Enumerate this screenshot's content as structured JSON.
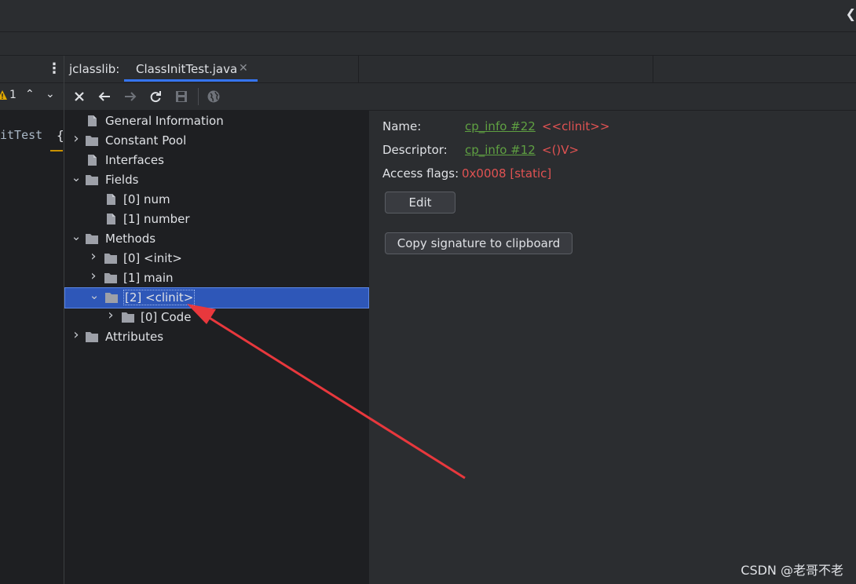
{
  "editor": {
    "warning_count": "1",
    "code_text": "itTest",
    "code_brace": "{"
  },
  "tabs": {
    "plugin_label": "jclasslib:",
    "file_tab": "ClassInitTest.java"
  },
  "toolbar": {
    "buttons": [
      "close-icon",
      "back-icon",
      "forward-icon",
      "refresh-icon",
      "save-icon",
      "browser-icon"
    ]
  },
  "tree": {
    "items": [
      {
        "label": "General Information",
        "kind": "file",
        "expand": "none"
      },
      {
        "label": "Constant Pool",
        "kind": "folder",
        "expand": "collapsed"
      },
      {
        "label": "Interfaces",
        "kind": "file",
        "expand": "none"
      },
      {
        "label": "Fields",
        "kind": "folder",
        "expand": "expanded"
      },
      {
        "label": "[0] num",
        "kind": "file",
        "expand": "none"
      },
      {
        "label": "[1] number",
        "kind": "file",
        "expand": "none"
      },
      {
        "label": "Methods",
        "kind": "folder",
        "expand": "expanded"
      },
      {
        "label": "[0] <init>",
        "kind": "folder",
        "expand": "collapsed"
      },
      {
        "label": "[1] main",
        "kind": "folder",
        "expand": "collapsed"
      },
      {
        "label": "[2] <clinit>",
        "kind": "folder",
        "expand": "expanded",
        "selected": true
      },
      {
        "label": "[0] Code",
        "kind": "folder",
        "expand": "collapsed"
      },
      {
        "label": "Attributes",
        "kind": "folder",
        "expand": "collapsed"
      }
    ]
  },
  "detail": {
    "name_label": "Name:",
    "name_link": "cp_info #22",
    "name_value": "<<clinit>>",
    "descriptor_label": "Descriptor:",
    "descriptor_link": "cp_info #12",
    "descriptor_value": "<()V>",
    "flags_label": "Access flags:",
    "flags_value": "0x0008 [static]",
    "edit_button": "Edit",
    "copy_button": "Copy signature to clipboard"
  },
  "watermark": "CSDN @老哥不老",
  "colors": {
    "selection": "#2e57b8",
    "link": "#5fa042",
    "value_red": "#e05252",
    "tab_accent": "#3574f0",
    "annotation_arrow": "#e8383d"
  }
}
